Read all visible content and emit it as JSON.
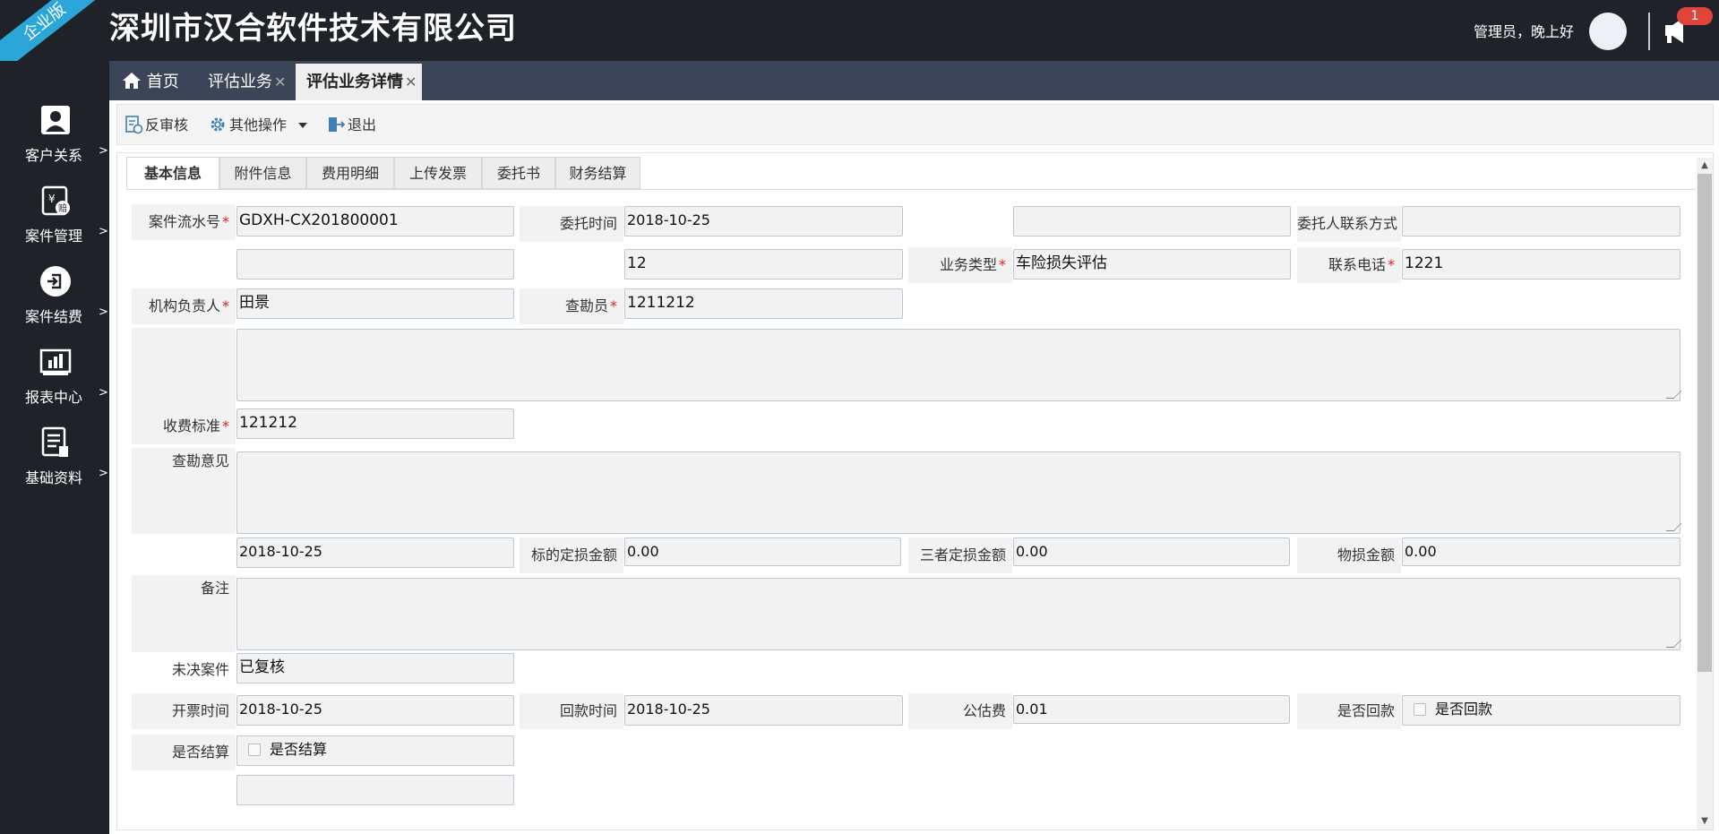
{
  "header": {
    "edition_badge": "企业版",
    "company_title": "深圳市汉合软件技术有限公司",
    "greeting": "管理员，晚上好",
    "notification_count": "1"
  },
  "sidebar": {
    "items": [
      {
        "label": "客户关系",
        "arrow": ">",
        "icon": "user-icon"
      },
      {
        "label": "案件管理",
        "arrow": ">",
        "icon": "case-icon"
      },
      {
        "label": "案件结费",
        "arrow": ">",
        "icon": "sign-in-icon"
      },
      {
        "label": "报表中心",
        "arrow": ">",
        "icon": "report-chart-icon"
      },
      {
        "label": "基础资料",
        "arrow": ">",
        "icon": "documents-icon"
      }
    ]
  },
  "tabs": {
    "home": "首页",
    "items": [
      {
        "label": "评估业务",
        "close": "✕"
      },
      {
        "label": "评估业务详情",
        "close": "✕",
        "active": true
      }
    ]
  },
  "toolbar": {
    "unreview": "反审核",
    "other_ops": "其他操作",
    "exit": "退出"
  },
  "subtabs": [
    "基本信息",
    "附件信息",
    "费用明细",
    "上传发票",
    "委托书",
    "财务结算"
  ],
  "form": {
    "case_no_label": "案件流水号",
    "case_no": "GDXH-CX201800001",
    "entrust_time_label": "委托时间",
    "entrust_time": "2018-10-25",
    "blank_field_1": "",
    "client_contact_label": "委托人联系方式",
    "client_contact": "",
    "blank_field_2": "",
    "field_12": "12",
    "biz_type_label": "业务类型",
    "biz_type": "车险损失评估",
    "phone_label": "联系电话",
    "phone": "1221",
    "org_head_label": "机构负责人",
    "org_head": "田景",
    "surveyor_label": "查勘员",
    "surveyor": "1211212",
    "fee_std_label": "收费标准",
    "fee_std": "121212",
    "survey_opinion_label": "查勘意见",
    "date_field": "2018-10-25",
    "target_loss_label": "标的定损金额",
    "target_loss": "0.00",
    "third_loss_label": "三者定损金额",
    "third_loss": "0.00",
    "property_loss_label": "物损金额",
    "property_loss": "0.00",
    "remark_label": "备注",
    "pending_label": "未决案件",
    "pending": "已复核",
    "invoice_time_label": "开票时间",
    "invoice_time": "2018-10-25",
    "payback_time_label": "回款时间",
    "payback_time": "2018-10-25",
    "public_fee_label": "公估费",
    "public_fee": "0.01",
    "is_paid_label": "是否回款",
    "is_paid_check": "是否回款",
    "is_settled_label": "是否结算",
    "is_settled_check": "是否结算"
  },
  "colors": {
    "header_bg": "#1f2329",
    "tabbar_bg": "#3c4457",
    "accent_ribbon": "#2aa7d8",
    "badge_red": "#e0453b"
  }
}
